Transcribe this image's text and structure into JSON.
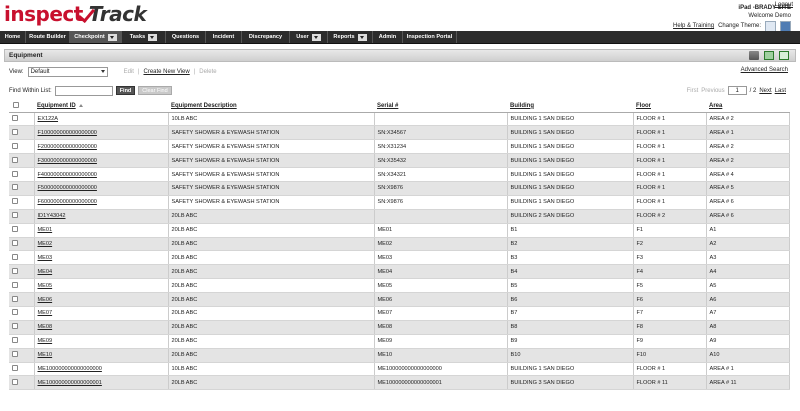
{
  "header": {
    "logo_part1": "inspect",
    "logo_part2": "Track",
    "logout": "Logout",
    "site_name": "iPad -BRADY SITE",
    "welcome": "Welcome Demo",
    "help": "Help & Training",
    "theme_label": "Change Theme:"
  },
  "nav": [
    {
      "label": "Home",
      "dropdown": false
    },
    {
      "label": "Route Builder",
      "dropdown": false
    },
    {
      "label": "Checkpoint",
      "dropdown": true,
      "active": true
    },
    {
      "label": "Tasks",
      "dropdown": true
    },
    {
      "label": "Questions",
      "dropdown": false
    },
    {
      "label": "Incident",
      "dropdown": false
    },
    {
      "label": "Discrepancy",
      "dropdown": false
    },
    {
      "label": "User",
      "dropdown": true
    },
    {
      "label": "Reports",
      "dropdown": true
    },
    {
      "label": "Admin",
      "dropdown": false
    },
    {
      "label": "Inspection Portal",
      "dropdown": false
    }
  ],
  "section": {
    "title": "Equipment",
    "icons": [
      "printer-icon",
      "export-icon",
      "excel-icon"
    ]
  },
  "viewbar": {
    "view_label": "View:",
    "view_value": "Default",
    "edit": "Edit",
    "create": "Create New View",
    "delete": "Delete",
    "advanced": "Advanced Search"
  },
  "find": {
    "label": "Find Within List:",
    "value": "",
    "find_btn": "Find",
    "clear_btn": "Clear Find"
  },
  "pager": {
    "first": "First",
    "previous": "Previous",
    "page": "1",
    "of": "/ 2",
    "next": "Next",
    "last": "Last"
  },
  "table": {
    "columns": [
      "Equipment ID",
      "Equipment Description",
      "Serial #",
      "Building",
      "Floor",
      "Area"
    ],
    "rows": [
      [
        "EX122A",
        "10LB ABC",
        "",
        "BUILDING 1 SAN DIEGO",
        "FLOOR # 1",
        "AREA # 2"
      ],
      [
        "F100000000000000000",
        "SAFETY SHOWER & EYEWASH STATION",
        "SN:X34567",
        "BUILDING 1 SAN DIEGO",
        "FLOOR # 1",
        "AREA # 1"
      ],
      [
        "F200000000000000000",
        "SAFETY SHOWER & EYEWASH STATION",
        "SN:X31234",
        "BUILDING 1 SAN DIEGO",
        "FLOOR # 1",
        "AREA # 2"
      ],
      [
        "F300000000000000000",
        "SAFETY SHOWER & EYEWASH STATION",
        "SN:X35432",
        "BUILDING 1 SAN DIEGO",
        "FLOOR # 1",
        "AREA # 2"
      ],
      [
        "F400000000000000000",
        "SAFETY SHOWER & EYEWASH STATION",
        "SN:X34321",
        "BUILDING 1 SAN DIEGO",
        "FLOOR # 1",
        "AREA # 4"
      ],
      [
        "F500000000000000000",
        "SAFETY SHOWER & EYEWASH STATION",
        "SN:X9876",
        "BUILDING 1 SAN DIEGO",
        "FLOOR # 1",
        "AREA # 5"
      ],
      [
        "F600000000000000000",
        "SAFETY SHOWER & EYEWASH STATION",
        "SN:X9876",
        "BUILDING 1 SAN DIEGO",
        "FLOOR # 1",
        "AREA # 6"
      ],
      [
        "ID1Y43042",
        "20LB ABC",
        "",
        "BUILDING 2 SAN DIEGO",
        "FLOOR # 2",
        "AREA # 6"
      ],
      [
        "ME01",
        "20LB ABC",
        "ME01",
        "B1",
        "F1",
        "A1"
      ],
      [
        "ME02",
        "20LB ABC",
        "ME02",
        "B2",
        "F2",
        "A2"
      ],
      [
        "ME03",
        "20LB ABC",
        "ME03",
        "B3",
        "F3",
        "A3"
      ],
      [
        "ME04",
        "20LB ABC",
        "ME04",
        "B4",
        "F4",
        "A4"
      ],
      [
        "ME05",
        "20LB ABC",
        "ME05",
        "B5",
        "F5",
        "A5"
      ],
      [
        "ME06",
        "20LB ABC",
        "ME06",
        "B6",
        "F6",
        "A6"
      ],
      [
        "ME07",
        "20LB ABC",
        "ME07",
        "B7",
        "F7",
        "A7"
      ],
      [
        "ME08",
        "20LB ABC",
        "ME08",
        "B8",
        "F8",
        "A8"
      ],
      [
        "ME09",
        "20LB ABC",
        "ME09",
        "B9",
        "F9",
        "A9"
      ],
      [
        "ME10",
        "20LB ABC",
        "ME10",
        "B10",
        "F10",
        "A10"
      ],
      [
        "ME100000000000000000",
        "10LB ABC",
        "ME100000000000000000",
        "BUILDING 1 SAN DIEGO",
        "FLOOR # 1",
        "AREA # 1"
      ],
      [
        "ME100000000000000001",
        "20LB ABC",
        "ME100000000000000001",
        "BUILDING 3 SAN DIEGO",
        "FLOOR # 11",
        "AREA # 11"
      ]
    ]
  }
}
